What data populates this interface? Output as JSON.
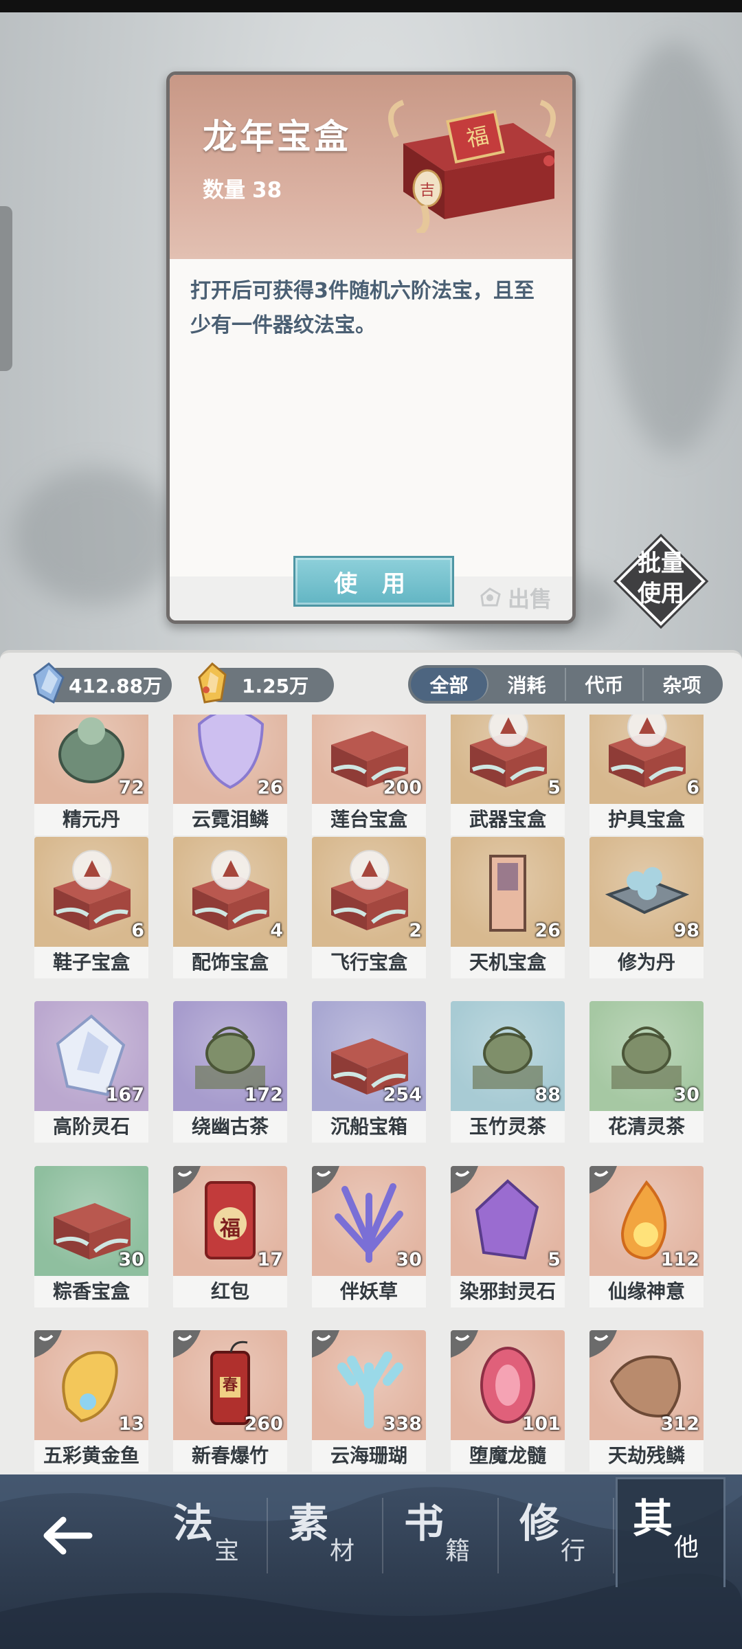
{
  "detail": {
    "title": "龙年宝盒",
    "quantity_label": "数量",
    "quantity": "38",
    "description": "打开后可获得3件随机六阶法宝，且至少有一件器纹法宝。",
    "box_emblem": "福",
    "box_tag": "吉",
    "use_label": "使 用",
    "sell_label": "出售"
  },
  "batch": {
    "line1": "批量",
    "line2": "使用"
  },
  "currencies": {
    "spirit_stone": "412.88万",
    "jade": "1.25万"
  },
  "filters": [
    {
      "label": "全部",
      "active": true
    },
    {
      "label": "消耗",
      "active": false
    },
    {
      "label": "代币",
      "active": false
    },
    {
      "label": "杂项",
      "active": false
    }
  ],
  "items": [
    {
      "name": "精元丹",
      "count": "72",
      "bg": "#e0b59f",
      "icon": "pill-cauldron-icon"
    },
    {
      "name": "云霓泪鳞",
      "count": "26",
      "bg": "#e1b7a3",
      "icon": "scale-crystal-icon"
    },
    {
      "name": "莲台宝盒",
      "count": "200",
      "bg": "#e3b9a4",
      "icon": "lotus-chest-icon"
    },
    {
      "name": "武器宝盒",
      "count": "5",
      "bg": "#d7b88e",
      "icon": "weapon-chest-icon"
    },
    {
      "name": "护具宝盒",
      "count": "6",
      "bg": "#d7b88e",
      "icon": "armor-chest-icon"
    },
    {
      "name": "鞋子宝盒",
      "count": "6",
      "bg": "#d8b98f",
      "icon": "shoe-chest-icon"
    },
    {
      "name": "配饰宝盒",
      "count": "4",
      "bg": "#d8b98f",
      "icon": "accessory-chest-icon"
    },
    {
      "name": "飞行宝盒",
      "count": "2",
      "bg": "#d8b98f",
      "icon": "flight-chest-icon"
    },
    {
      "name": "天机宝盒",
      "count": "26",
      "bg": "#d8b98f",
      "icon": "secret-pillar-icon"
    },
    {
      "name": "修为丹",
      "count": "98",
      "bg": "#d8b98f",
      "icon": "pill-tray-icon"
    },
    {
      "name": "高阶灵石",
      "count": "167",
      "bg": "#bba8cf",
      "icon": "spirit-crystal-icon"
    },
    {
      "name": "绕幽古茶",
      "count": "172",
      "bg": "#a79ccd",
      "icon": "teapot-purple-icon"
    },
    {
      "name": "沉船宝箱",
      "count": "254",
      "bg": "#a9a8d2",
      "icon": "shipwreck-chest-icon"
    },
    {
      "name": "玉竹灵茶",
      "count": "88",
      "bg": "#a8cbd4",
      "icon": "jade-teapot-icon"
    },
    {
      "name": "花清灵茶",
      "count": "30",
      "bg": "#a6c8a3",
      "icon": "flower-tea-icon"
    },
    {
      "name": "粽香宝盒",
      "count": "30",
      "bg": "#8fbf9f",
      "icon": "zongzi-chest-icon"
    },
    {
      "name": "红包",
      "count": "17",
      "bg": "#e3b6a3",
      "icon": "red-envelope-icon"
    },
    {
      "name": "伴妖草",
      "count": "30",
      "bg": "#e3b6a3",
      "icon": "demon-grass-icon"
    },
    {
      "name": "染邪封灵石",
      "count": "5",
      "bg": "#e3b6a3",
      "icon": "sealed-stone-icon"
    },
    {
      "name": "仙缘神意",
      "count": "112",
      "bg": "#e3b6a3",
      "icon": "spirit-flame-icon"
    },
    {
      "name": "五彩黄金鱼",
      "count": "13",
      "bg": "#e3b6a3",
      "icon": "golden-fish-icon"
    },
    {
      "name": "新春爆竹",
      "count": "260",
      "bg": "#e3b6a3",
      "icon": "firecracker-icon"
    },
    {
      "name": "云海珊瑚",
      "count": "338",
      "bg": "#e3b6a3",
      "icon": "coral-icon"
    },
    {
      "name": "堕魔龙髓",
      "count": "101",
      "bg": "#e3b6a3",
      "icon": "dragon-marrow-icon"
    },
    {
      "name": "天劫残鳞",
      "count": "312",
      "bg": "#e3b6a3",
      "icon": "tribulation-scale-icon"
    }
  ],
  "firecracker_char": "春",
  "envelope_char": "福",
  "nav": [
    {
      "main": "法",
      "sub": "宝"
    },
    {
      "main": "素",
      "sub": "材"
    },
    {
      "main": "书",
      "sub": "籍"
    },
    {
      "main": "修",
      "sub": "行"
    },
    {
      "main": "其",
      "sub": "他"
    }
  ],
  "colors": {
    "accent": "#4d6580",
    "use_button": "#7cc4d0",
    "card_header": "#d4a897",
    "nav_bg": "#34445a"
  }
}
